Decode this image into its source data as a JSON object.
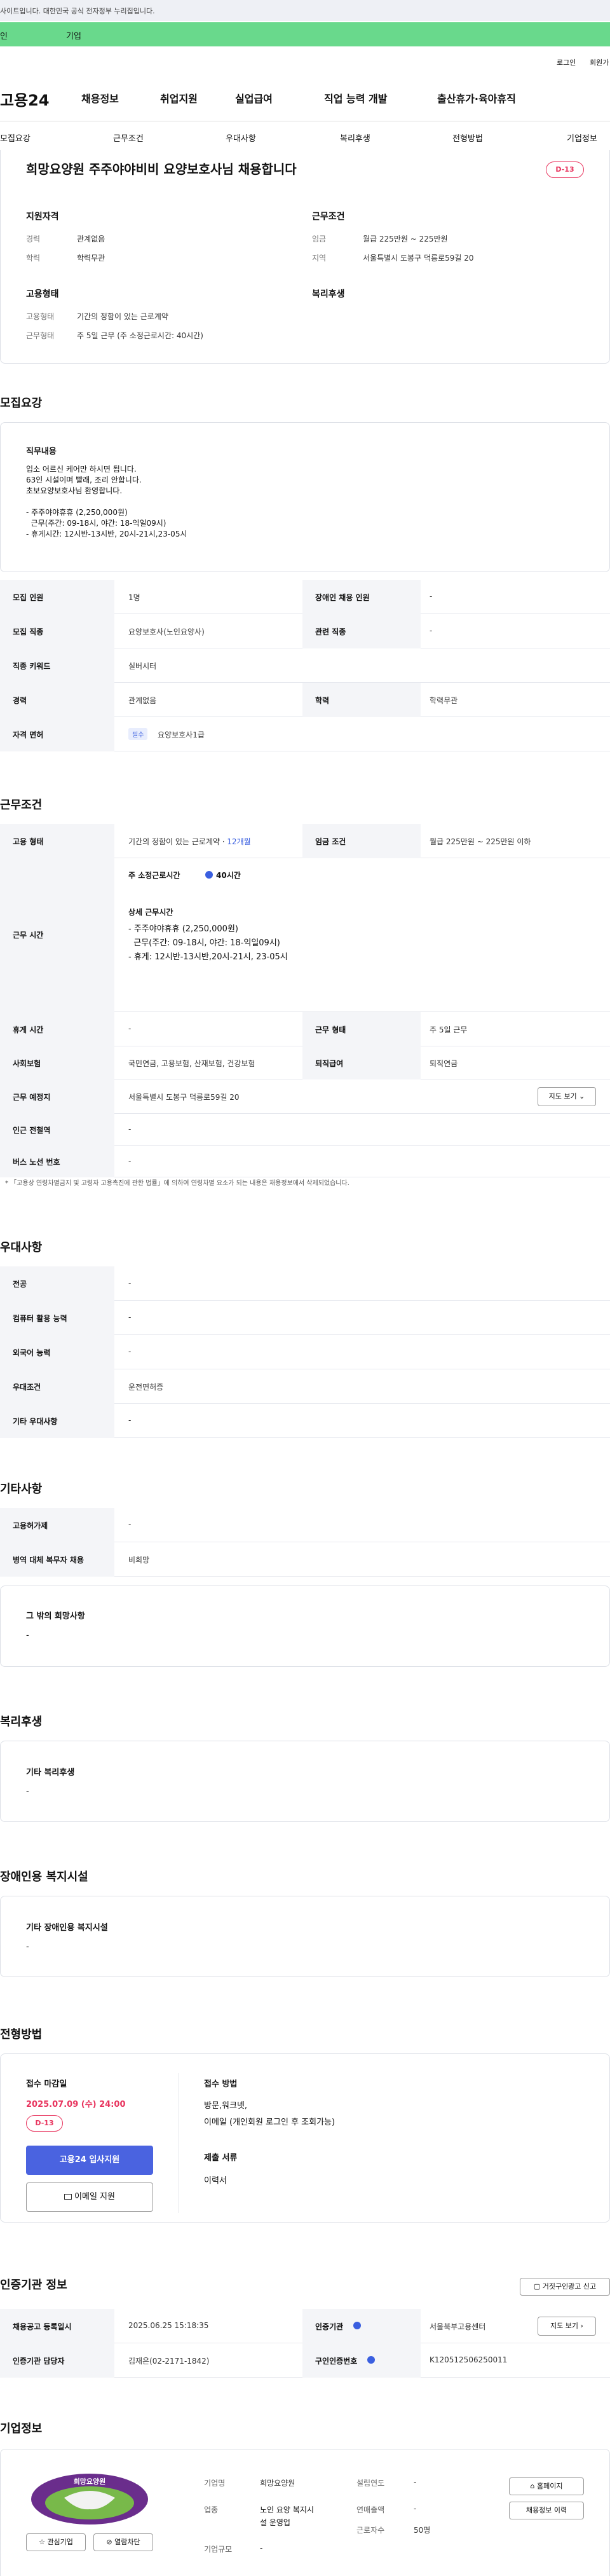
{
  "header": {
    "gov_notice": "사이트입니다. 대한민국 공식 전자정부 누리집입니다.",
    "tab_personal": "인",
    "tab_company": "기업",
    "login": "로그인",
    "signup": "회원가",
    "logo": "고용24",
    "nav": [
      "채용정보",
      "취업지원",
      "실업급여",
      "직업 능력 개발",
      "출산휴가·육아휴직"
    ],
    "subnav": [
      "모집요강",
      "근무조건",
      "우대사항",
      "복리후생",
      "전형방법",
      "기업정보"
    ]
  },
  "summary": {
    "title": "희망요양원 주주야야비비 요양보호사님 채용합니다",
    "dday": "D-13",
    "qual_title": "지원자격",
    "career_label": "경력",
    "career": "관계없음",
    "edu_label": "학력",
    "edu": "학력무관",
    "cond_title": "근무조건",
    "wage_label": "임금",
    "wage": "월급 225만원 ~ 225만원",
    "region_label": "지역",
    "region": "서울특별시 도봉구 덕릉로59길 20",
    "emp_title": "고용형태",
    "emp_label": "고용형태",
    "emp": "기간의 정함이 있는 근로계약",
    "work_label": "근무형태",
    "work": "주 5일 근무 (주 소정근로시간: 40시간)",
    "welfare_title": "복리후생"
  },
  "recruit": {
    "title": "모집요강",
    "duty_title": "직무내용",
    "duty_lines": [
      "입소 어르신 케어만 하시면 됩니다.",
      "63인 시설이며 빨래, 조리 안합니다.",
      "초보요양보호사님 환영합니다.",
      "",
      "- 주주야야휴휴 (2,250,000원)",
      "  근무(주간: 09-18시, 야간: 18-익일09시)",
      "- 휴게시간: 12시반-13시반, 20시-21시,23-05시"
    ],
    "rows": [
      {
        "l": "모집 인원",
        "v": "1명",
        "l2": "장애인 채용 인원",
        "v2": "-"
      },
      {
        "l": "모집 직종",
        "v": "요양보호사(노인요양사)",
        "l2": "관련 직종",
        "v2": "-"
      },
      {
        "l": "직종 키워드",
        "v": "실버시터",
        "l2": "",
        "v2": ""
      },
      {
        "l": "경력",
        "v": "관계없음",
        "l2": "학력",
        "v2": "학력무관"
      },
      {
        "l": "자격 면허",
        "badge": "필수",
        "v": "요양보호사1급",
        "l2": "",
        "v2": ""
      }
    ]
  },
  "conditions": {
    "title": "근무조건",
    "emp_label": "고용 형태",
    "emp": "기간의 정함이 있는 근로계약 · ",
    "emp_months": "12개월",
    "wage_label": "임금 조건",
    "wage": "월급 225만원 ~ 225만원 이하",
    "hours_label": "근무 시간",
    "hours_head": "주 소정근로시간 ",
    "hours_val": "40시간",
    "detail_title": "상세 근무시간",
    "detail_lines": [
      "- 주주야야휴휴 (2,250,000원)",
      "  근무(주간: 09-18시, 야간: 18-익일09시)",
      "- 휴게: 12시반-13시반,20시-21시, 23-05시"
    ],
    "rest_label": "휴게 시간",
    "rest": "-",
    "form_label": "근무 형태",
    "form": "주 5일 근무",
    "ins_label": "사회보험",
    "ins": "국민연금, 고용보험, 산재보험, 건강보험",
    "sev_label": "퇴직급여",
    "sev": "퇴직연금",
    "place_label": "근무 예정지",
    "place": "서울특별시 도봉구 덕릉로59길 20",
    "map_btn": "지도 보기",
    "station_label": "인근 전철역",
    "station": "-",
    "bus_label": "버스 노선 번호",
    "bus": "-",
    "notice": "* 「고용상 연령차별금지 및 고령자 고용촉진에 관한 법률」에 의하여 연령차별 요소가 되는 내용은 채용정보에서 삭제되었습니다."
  },
  "pref": {
    "title": "우대사항",
    "rows": [
      {
        "l": "전공",
        "v": "-"
      },
      {
        "l": "컴퓨터 활용 능력",
        "v": "-"
      },
      {
        "l": "외국어 능력",
        "v": "-"
      },
      {
        "l": "우대조건",
        "v": "운전면허증"
      },
      {
        "l": "기타 우대사항",
        "v": "-"
      }
    ]
  },
  "etc": {
    "title": "기타사항",
    "rows": [
      {
        "l": "고용허가제",
        "v": "-"
      },
      {
        "l": "병역 대체 복무자 채용",
        "v": "비희망"
      }
    ],
    "other_title": "그 밖의 희망사항",
    "other": "-"
  },
  "welfare": {
    "title": "복리후생",
    "box_title": "기타 복리후생",
    "box_val": "-"
  },
  "disabled": {
    "title": "장애인용 복지시설",
    "box_title": "기타 장애인용 복지시설",
    "box_val": "-"
  },
  "process": {
    "title": "전형방법",
    "deadline_label": "접수 마감일",
    "deadline": "2025.07.09 (수) 24:00",
    "dday": "D-13",
    "apply_btn": "고용24 입사지원",
    "email_btn": "이메일 지원",
    "method_label": "접수 방법",
    "method_lines": [
      "방문,워크넷,",
      "이메일 (개인회원 로그인 후 조회가능)"
    ],
    "docs_label": "제출 서류",
    "docs": "이력서"
  },
  "agency": {
    "title": "인증기관 정보",
    "report_btn": "거짓구인광고 신고",
    "reg_label": "채용공고 등록일시",
    "reg": "2025.06.25 15:18:35",
    "agency_label": "인증기관",
    "agency": "서울북부고용센터",
    "map_btn": "지도 보기",
    "staff_label": "인증기관 담당자",
    "staff": "김재은(02-2171-1842)",
    "num_label": "구인인증번호",
    "num": "K120512506250011"
  },
  "company": {
    "title": "기업정보",
    "fav_btn": "관심기업",
    "block_btn": "열람차단",
    "name_label": "기업명",
    "name": "희망요양원",
    "year_label": "설립연도",
    "year": "-",
    "ind_label": "업종",
    "ind_lines": [
      "노인 요양 복지시",
      "설 운영업"
    ],
    "sales_label": "연매출액",
    "sales": "-",
    "emp_label": "근로자수",
    "emp": "50명",
    "size_label": "기업규모",
    "size": "-",
    "home_btn": "홈페이지",
    "jobs_btn": "채용정보 이력"
  },
  "colors": {
    "accent": "#3a5fe0",
    "green": "#69d98c",
    "dday": "#e8345e"
  }
}
